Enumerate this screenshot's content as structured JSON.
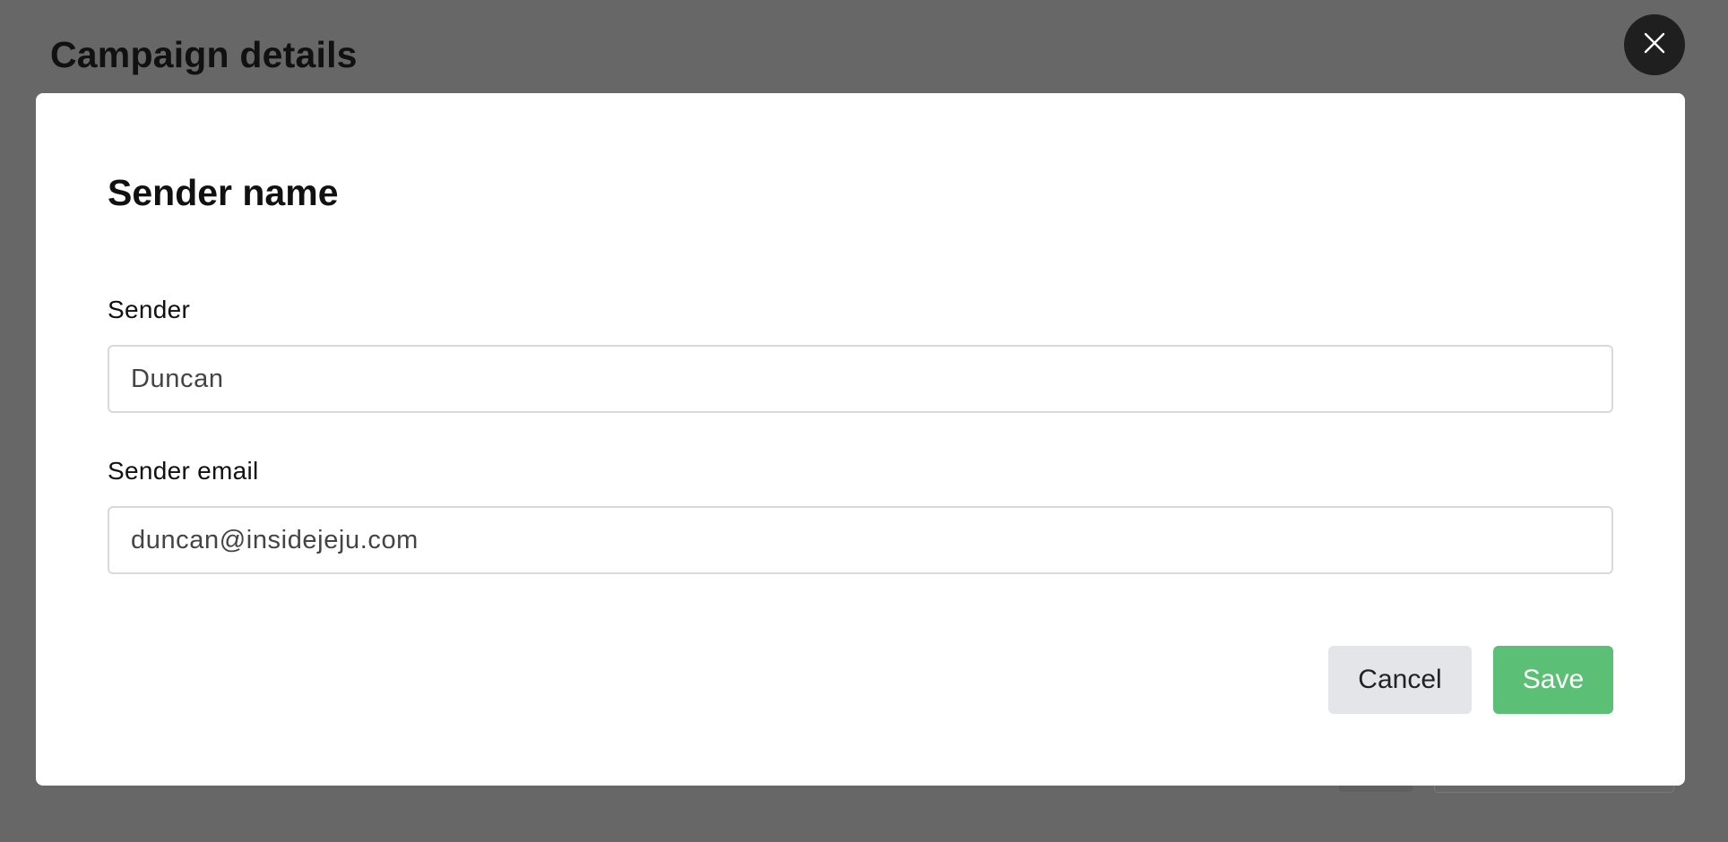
{
  "page": {
    "title": "Campaign details"
  },
  "close_icon": "close-icon",
  "modal": {
    "title": "Sender name",
    "sender": {
      "label": "Sender",
      "value": "Duncan"
    },
    "sender_email": {
      "label": "Sender email",
      "value": "duncan@insidejeju.com"
    },
    "cancel_label": "Cancel",
    "save_label": "Save"
  },
  "colors": {
    "backdrop": "#676767",
    "close_button": "#1f1f1f",
    "save_button": "#5bbf75",
    "cancel_button": "#e4e5e8"
  }
}
